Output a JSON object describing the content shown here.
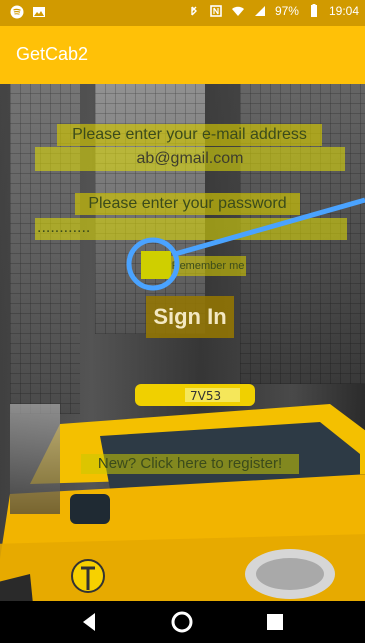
{
  "status_bar": {
    "battery_text": "97%",
    "time": "19:04",
    "icons": [
      "spotify-icon",
      "image-icon",
      "bluetooth-icon",
      "nfc-icon",
      "wifi-icon",
      "signal-icon",
      "battery-icon"
    ]
  },
  "app_bar": {
    "title": "GetCab2"
  },
  "form": {
    "email_hint": "Please enter your e-mail address",
    "email_value": "ab@gmail.com",
    "password_hint": "Please enter your password",
    "password_value": "............",
    "remember_label": "Remember me",
    "signin_label": "Sign In",
    "register_link": "New? Click here to register!"
  },
  "background": {
    "taxi_plate": "7V53"
  },
  "colors": {
    "app_bar": "#ffc107",
    "status_bar": "#d19a00",
    "highlight_ring": "#4aa3ff"
  },
  "navigation": {
    "buttons": [
      "back-icon",
      "home-icon",
      "recents-icon"
    ]
  }
}
